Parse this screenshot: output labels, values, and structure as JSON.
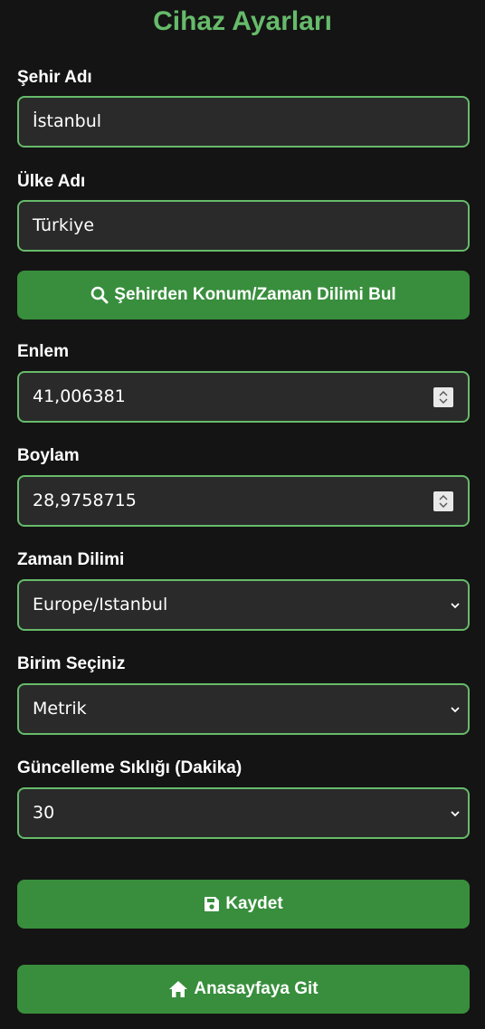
{
  "page": {
    "title": "Cihaz Ayarları"
  },
  "city": {
    "label": "Şehir Adı",
    "value": "İstanbul"
  },
  "country": {
    "label": "Ülke Adı",
    "value": "Türkiye"
  },
  "find_button": {
    "label": "Şehirden Konum/Zaman Dilimi Bul",
    "icon": "search-icon"
  },
  "latitude": {
    "label": "Enlem",
    "value": "41,006381"
  },
  "longitude": {
    "label": "Boylam",
    "value": "28,9758715"
  },
  "timezone": {
    "label": "Zaman Dilimi",
    "selected": "Europe/Istanbul"
  },
  "unit": {
    "label": "Birim Seçiniz",
    "selected": "Metrik"
  },
  "refresh": {
    "label": "Güncelleme Sıklığı (Dakika)",
    "selected": "30"
  },
  "save_button": {
    "label": "Kaydet",
    "icon": "save-icon"
  },
  "home_button": {
    "label": "Anasayfaya Git",
    "icon": "home-icon"
  },
  "colors": {
    "accent": "#66bb6a",
    "button": "#388e3c",
    "background": "#141414",
    "field": "#2a2a2a"
  }
}
